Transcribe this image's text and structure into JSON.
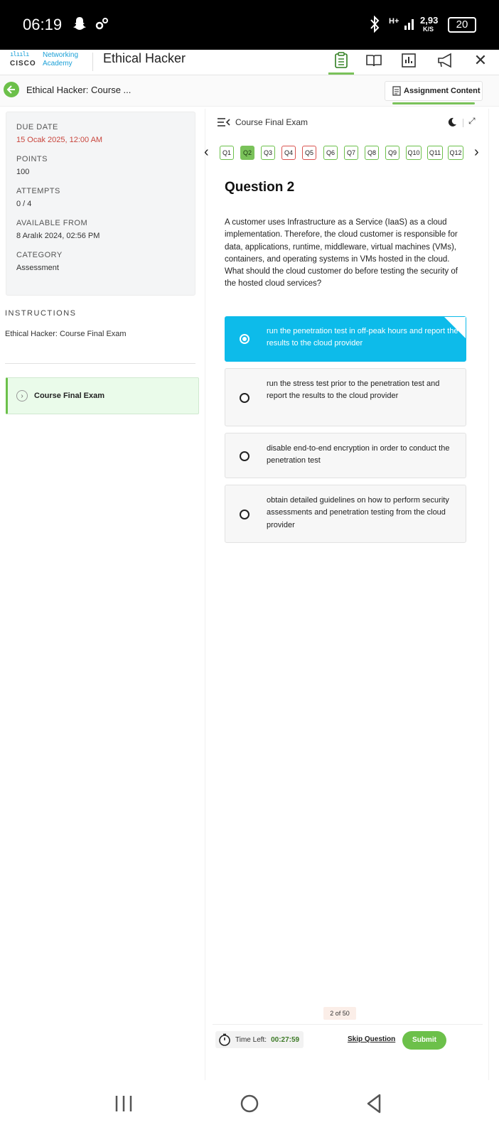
{
  "status_bar": {
    "time": "06:19",
    "network": "H+",
    "speed_value": "2,93",
    "speed_unit": "K/S",
    "battery": "20"
  },
  "app_bar": {
    "logo_company": "CISCO",
    "logo_line1": "Networking",
    "logo_line2": "Academy",
    "title": "Ethical Hacker",
    "icons": [
      "clipboard-list-icon",
      "book-icon",
      "chart-icon",
      "megaphone-icon",
      "close-icon"
    ]
  },
  "breadcrumb": {
    "title": "Ethical Hacker: Course ...",
    "tab_label": "Assignment Content"
  },
  "info": {
    "due_label": "DUE DATE",
    "due_value": "15 Ocak 2025, 12:00 AM",
    "points_label": "POINTS",
    "points_value": "100",
    "attempts_label": "ATTEMPTS",
    "attempts_value": "0 / 4",
    "available_label": "AVAILABLE FROM",
    "available_value": "8 Aralık 2024, 02:56 PM",
    "category_label": "CATEGORY",
    "category_value": "Assessment"
  },
  "instructions": {
    "heading": "INSTRUCTIONS",
    "text": "Ethical Hacker: Course Final Exam"
  },
  "module": {
    "label": "Course Final Exam"
  },
  "exam": {
    "header": "Course Final Exam",
    "questions": [
      {
        "label": "Q1",
        "state": "answered"
      },
      {
        "label": "Q2",
        "state": "current"
      },
      {
        "label": "Q3",
        "state": "answered"
      },
      {
        "label": "Q4",
        "state": "flagged"
      },
      {
        "label": "Q5",
        "state": "flagged"
      },
      {
        "label": "Q6",
        "state": "answered"
      },
      {
        "label": "Q7",
        "state": "answered"
      },
      {
        "label": "Q8",
        "state": "answered"
      },
      {
        "label": "Q9",
        "state": "answered"
      },
      {
        "label": "Q10",
        "state": "answered"
      },
      {
        "label": "Q11",
        "state": "answered"
      },
      {
        "label": "Q12",
        "state": "answered"
      }
    ],
    "question_title": "Question 2",
    "question_text": "A customer uses Infrastructure as a Service (IaaS) as a cloud implementation. Therefore, the cloud customer is responsible for data, applications, runtime, middleware, virtual machines (VMs), containers, and operating systems in VMs hosted in the cloud. What should the cloud customer do before testing the security of the hosted cloud services?",
    "options": [
      {
        "text": "run the penetration test in off-peak hours and report the results to the cloud provider",
        "selected": true
      },
      {
        "text": "run the stress test prior to the penetration test and report the results to the cloud provider",
        "selected": false
      },
      {
        "text": "disable end-to-end encryption in order to conduct the penetration test",
        "selected": false
      },
      {
        "text": "obtain detailed guidelines on how to perform security assessments and penetration testing from the cloud provider",
        "selected": false
      }
    ],
    "page_count": "2 of 50",
    "time_left_label": "Time Left:",
    "time_left_value": "00:27:59",
    "skip_label": "Skip Question",
    "submit_label": "Submit"
  },
  "colors": {
    "accent_green": "#6cc04a",
    "selected_blue": "#0dbbea",
    "due_red": "#c9463d"
  }
}
